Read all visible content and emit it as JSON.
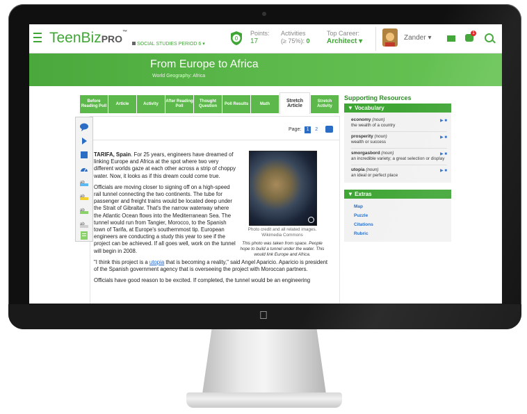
{
  "header": {
    "logo_main": "TeenBiz",
    "logo_pro": "PRO",
    "logo_tm": "™",
    "period": "SOCIAL STUDIES PERIOD 6",
    "badge_value": "0",
    "points_label": "Points:",
    "points_value": "17",
    "activities_label": "Activities",
    "activities_sub": "(≥ 75%):",
    "activities_value": "0",
    "career_label": "Top Career:",
    "career_value": "Architect",
    "user_name": "Zander",
    "notification_count": "1"
  },
  "banner": {
    "title": "From Europe to Africa",
    "subtitle": "World Geography: Africa"
  },
  "tabs": [
    {
      "label": "Before Reading Poll"
    },
    {
      "label": "Article"
    },
    {
      "label": "Activity"
    },
    {
      "label": "After Reading Poll"
    },
    {
      "label": "Thought Question"
    },
    {
      "label": "Poll Results"
    },
    {
      "label": "Math"
    },
    {
      "label": "Stretch Article"
    },
    {
      "label": "Stretch Activity"
    }
  ],
  "article": {
    "page_label": "Page:",
    "page_current": "1",
    "page_next": "2",
    "dateline": "TARIFA, Spain",
    "p1_rest": ". For 25 years, engineers have dreamed of linking Europe and Africa at the spot where two very different worlds gaze at each other across a strip of choppy water. Now, it looks as if this dream could come true.",
    "p2": "Officials are moving closer to signing off on a high-speed rail tunnel connecting the two continents. The tube for passenger and freight trains would be located deep under the Strait of Gibraltar. That's the narrow waterway where the Atlantic Ocean flows into the Mediterranean Sea. The tunnel would run from Tangier, Morocco, to the Spanish town of Tarifa, at Europe's southernmost tip. European engineers are conducting a study this year to see if the project can be achieved. If all goes well, work on the tunnel will begin in 2008.",
    "p3_a": "\"I think this project is a ",
    "p3_link": "utopia",
    "p3_b": " that is becoming a reality,\" said Angel Aparicio. Aparicio is president of the Spanish government agency that is overseeing the project with Moroccan partners.",
    "p4": "Officials have good reason to be excited. If completed, the tunnel would be an engineering",
    "photo_credit": "Photo credit and all related images. Wikimedia Commons",
    "photo_caption": "This photo was taken from space. People hope to build a tunnel under the water. This would link Europe and Africa."
  },
  "resources": {
    "title": "Supporting Resources",
    "vocab_header": "Vocabulary",
    "vocab": [
      {
        "word": "economy",
        "pos": "(noun)",
        "def": "the wealth of a country"
      },
      {
        "word": "prosperity",
        "pos": "(noun)",
        "def": "wealth or success"
      },
      {
        "word": "smorgasbord",
        "pos": "(noun)",
        "def": "an incredible variety; a great selection or display"
      },
      {
        "word": "utopia",
        "pos": "(noun)",
        "def": "an ideal or perfect place"
      }
    ],
    "extras_header": "Extras",
    "extras": [
      "Map",
      "Puzzle",
      "Citations",
      "Rubric"
    ]
  },
  "colors": {
    "brand_green": "#3fa535",
    "link_blue": "#2b6cc4"
  }
}
